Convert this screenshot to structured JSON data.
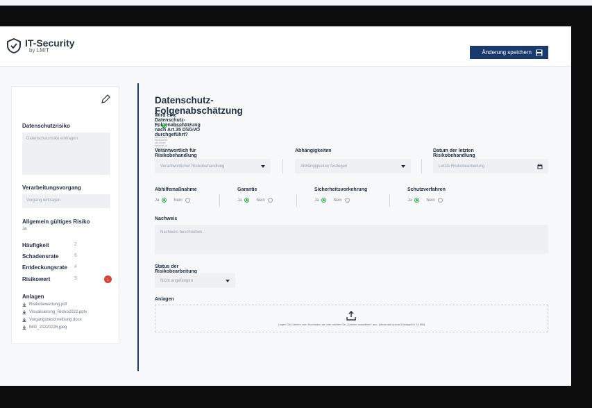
{
  "header": {
    "logo_title": "IT-Security",
    "logo_sub": "by LMIT",
    "save_label": "Änderung speichern"
  },
  "sidebar": {
    "datenschutzrisiko_label": "Datenschutzrisiko",
    "datenschutzrisiko_placeholder": "Datenschutzrisiko eintragen",
    "verarbeitung_label": "Verarbeitungsvorgang",
    "verarbeitung_placeholder": "Vorgang eintragen",
    "gueltig_label": "Allgemein gültiges Risiko",
    "gueltig_value": "Ja",
    "metrics": [
      {
        "label": "Häufigkeit",
        "value": "2"
      },
      {
        "label": "Schadensrate",
        "value": "6"
      },
      {
        "label": "Entdeckungsrate",
        "value": "4"
      },
      {
        "label": "Risikowert",
        "value": "9"
      }
    ],
    "attachments_label": "Anlagen",
    "attachments": [
      "Risikobewertung.pdf",
      "Visualisierung_Risiko2022.pptx",
      "Vorgangsbeschreibung.docx",
      "IMG_20220226.jpeg"
    ]
  },
  "main": {
    "title": "Datenschutz-Folgenabschätzung",
    "question": "Wird eine Datenschutz-Folgenabschätzung nach Art.35 DSGVO durchgeführt?",
    "yes": "Ja",
    "no": "Nein",
    "tiny_note": "Wird meine Risikowerte wie bisher bewertet, ja auswählen",
    "verantwortlich_label": "Verantwortlich für Risikobehandlung",
    "verantwortlich_placeholder": "Verantwortlicher Risikobehandlung",
    "abhaengigkeiten_label": "Abhängigkeiten",
    "abhaengigkeiten_placeholder": "Abhängigkeiten festlegen",
    "datum_label": "Datum der letzten Risikobehandlung",
    "datum_placeholder": "Letzte Risikobearbeitung",
    "abhilfe_label": "Abhilfemaßnahme",
    "garantie_label": "Garantie",
    "sicherheit_label": "Sicherheitsvorkehrung",
    "schutz_label": "Schutzverfahren",
    "nachweis_label": "Nachweis",
    "nachweis_placeholder": "Nachweis beschreiben...",
    "status_label": "Status der Risikobearbeitung",
    "status_value": "Nicht angefangen",
    "anlagen_label": "Anlagen",
    "upload_text": "Legen Sie Dateien zum Hochladen ab oder wählen Sie „Dateien auswählen“ aus. (Maximale upload Dateigröße 24 MB)"
  },
  "colors": {
    "accent": "#1a3a6e",
    "radio_on": "#2bb24a",
    "alert": "#d9433a"
  }
}
